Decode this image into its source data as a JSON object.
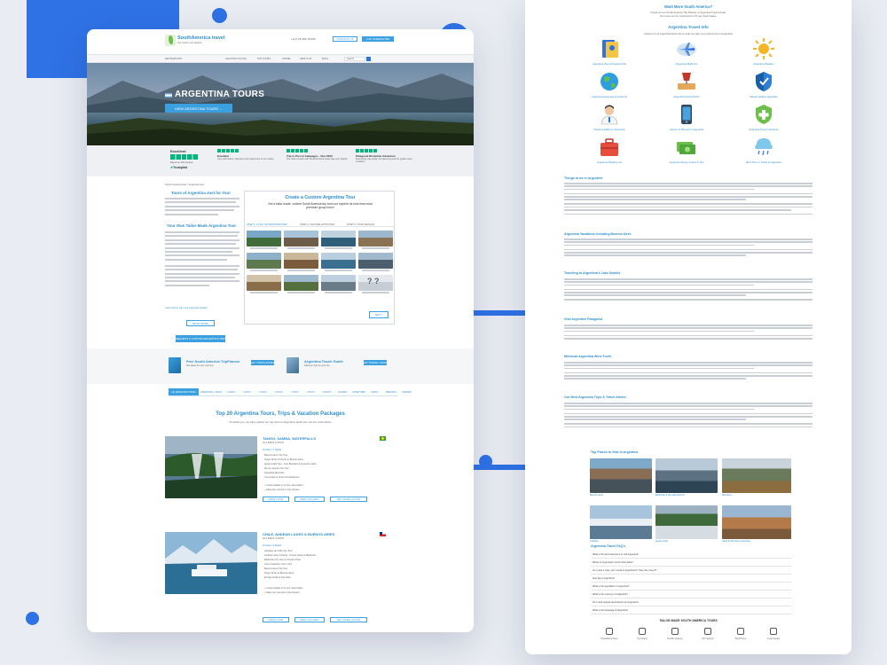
{
  "colors": {
    "accent": "#2f72e6",
    "link": "#2f8ecf",
    "green": "#6cc04a"
  },
  "left": {
    "logo": {
      "brand": "SouthAmerica travel",
      "tagline": "Our route is our passion"
    },
    "phone": "+1(1) 23-456-78-900",
    "header_buttons": [
      "CONTACT US",
      "LOG IN/REGISTER"
    ],
    "nav": [
      "DESTINATIONS",
      "VACATION STYLES",
      "TOP TOURS",
      "TRAVEL",
      "ABOUT US",
      "BLOG",
      "Search"
    ],
    "hero": {
      "title": "ARGENTINA TOURS",
      "button": "VIEW ARGENTINA TOURS →"
    },
    "reviews": {
      "rating": "Excellent",
      "based": "Based on 184 reviews",
      "trustpilot": "Trustpilot",
      "items": [
        {
          "title": "Excellent",
          "text": "Very informative, attentive and responsive to our needs."
        },
        {
          "title": "Trip to Peru & Galapagos - Nov 2023",
          "text": "Our main contact with SouthAmerica travel was very helpful."
        },
        {
          "title": "Patagonia Discipline Adventure",
          "text": "Everything was great, the planning and the guides were excellent."
        }
      ]
    },
    "breadcrumb": "South America travel > Argentina tours",
    "intro": {
      "title": "Tours of Argentina Just for You!",
      "subtitle": "Your Own Tailor-Made Argentina Tour",
      "link": "Learn how to plan your Argentina vacation"
    },
    "custom": {
      "title": "Create a Custom Argentina Tour",
      "lead": "Get a tailor-made, custom South America trip from our experts for less than most premium group tours!",
      "steps": [
        "STEP 1: CLICK ON DESTINATIONS",
        "STEP 2: CHOOSE ACTIVITIES",
        "STEP 3: TOUR DETAILS"
      ],
      "next": "NEXT"
    },
    "buttons": {
      "more": "READ MORE",
      "quote": "REQUEST A CUSTOM ARGENTINA TRIP"
    },
    "promos": [
      {
        "title": "Free South America TripPlanner",
        "text": "Get ideas for your next trip",
        "button": "GET TRIPPLANNER"
      },
      {
        "title": "Argentina Travel Guide",
        "text": "Discover tips for your trip",
        "button": "GET TRAVEL GUIDE"
      }
    ],
    "tabs": [
      "ALL ARGENTINA TOURS",
      "ARGENTINA + CHILE",
      "LUXURY",
      "4 DAYS",
      "5 DAYS",
      "6 DAYS",
      "7 DAYS",
      "8 DAYS",
      "10 DAYS",
      "BUDGET",
      "ADVENTURE",
      "FAMILY",
      "TREKKING",
      "CRUISES"
    ],
    "packages_title": "Top 20 Argentina Tours, Trips & Vacation Packages",
    "packages_sub": "To assist you, we have picked our top tours to Argentina. Each tour can be customized.",
    "tours": [
      {
        "title": "TANGO, SAMBA, WATERFALLS",
        "price": "from $3479 | 9 DAYS",
        "days": "10 Days / 9 Nights",
        "items": [
          "Buenos Aires City Tour",
          "Tango Show & Dinner at Buenos Aires",
          "Iguazu Falls Tour - from Brazilian & Argentine sides",
          "Rio de Janeiro City Tour",
          "Sugarloaf Mountain",
          "Corcovado & Christ the Redeemer"
        ],
        "tags": [
          "Customizable to fit your travel dates",
          "Allow tour and all on the itinerary"
        ],
        "buttons": [
          "VIEW TOUR",
          "VIEW GALLERY",
          "GET FREE QUOTE"
        ]
      },
      {
        "title": "CHILE, ANDEAN LAKES & BUENOS AIRES",
        "price": "from $3479 | 9 DAYS",
        "days": "10 Days / 9 Nights",
        "items": [
          "Santiago de Chile City Tour",
          "Andean Lake Crossing - Puerto Varas to Bariloche",
          "Bariloche City Tour & Circuito Chico",
          "Cerro Catedral / Cerro Otto",
          "Buenos Aires City Tour",
          "Tango Show at Buenos Aires",
          "El Tigre Delta & San Isidro"
        ],
        "tags": [
          "Customizable to fit your travel dates",
          "Allow tour and all on the itinerary"
        ],
        "buttons": [
          "VIEW TOUR",
          "VIEW GALLERY",
          "GET FREE QUOTE"
        ]
      }
    ]
  },
  "right": {
    "top": {
      "title": "Want More South America?",
      "text1": "Check out our South America Trip Planner or Argentina Travel Guide.",
      "text2": "Our tours can be customized to fit your travel dates."
    },
    "info": {
      "title": "Argentina Travel Info",
      "sub": "Check out our Argentina travel info to help you plan your perfect trip to Argentina!",
      "items": [
        {
          "label": "Argentina Visa & Passport Info",
          "icon": "passport-icon"
        },
        {
          "label": "Argentina Flight Info",
          "icon": "plane-icon"
        },
        {
          "label": "Argentina Weather",
          "icon": "sun-icon"
        },
        {
          "label": "Argentina Language & Customs",
          "icon": "globe-icon"
        },
        {
          "label": "Argentina Food & Drink",
          "icon": "wine-icon"
        },
        {
          "label": "Staying Safe in Argentina",
          "icon": "shield-icon"
        },
        {
          "label": "Staying Healthy in Argentina",
          "icon": "doctor-icon"
        },
        {
          "label": "Internet & Phones in Argentina",
          "icon": "phone-icon"
        },
        {
          "label": "Argentina Travel Insurance",
          "icon": "cross-shield-icon"
        },
        {
          "label": "Argentina Packing List",
          "icon": "suitcase-icon"
        },
        {
          "label": "Argentina Money, Prices & Tips",
          "icon": "money-icon"
        },
        {
          "label": "Best Time to Travel to Argentina",
          "icon": "calendar-icon"
        }
      ]
    },
    "sections": [
      "Things to do in Argentina",
      "Argentina Vacations Including Buenos Aires",
      "Traveling to Argentina's Lake District",
      "Visit Argentine Patagonia",
      "Mendoza Argentina Wine Tours",
      "Our Best Argentina Trips & Travel Advice"
    ],
    "places": {
      "title": "Top Places to Visit in Argentina",
      "items": [
        "Buenos Aires",
        "Bariloche & the Lake District",
        "Mendoza",
        "Calafate",
        "Iguazu Falls",
        "Salta & Northwest Argentina"
      ]
    },
    "faq": {
      "title": "Argentina Travel FAQ's",
      "items": [
        "What is the best travel time to visit Argentina?",
        "Where is Argentina's tourist information?",
        "Do I need a Visa, can I travel to Argentina if I have the correct?",
        "How big is Argentina?",
        "What is the population in Argentina?",
        "What is the currency of Argentina?",
        "Do I need special vaccinations for Argentina?",
        "What is the language of Argentina?"
      ]
    },
    "bottom": {
      "title": "TAILOR-MADE SOUTH AMERICA TOURS",
      "items": [
        "Handpicked Tours",
        "Our Hotels",
        "Flexible Itinerary",
        "24/7 Support",
        "Best Prices",
        "Local Guides"
      ]
    }
  }
}
